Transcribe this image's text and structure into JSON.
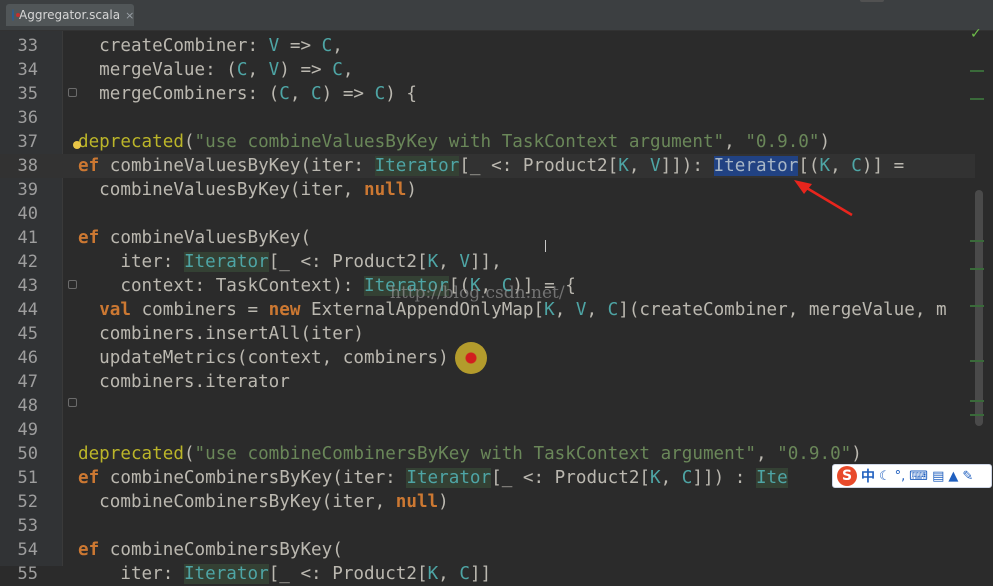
{
  "tab": {
    "title": "Aggregator.scala",
    "close": "×"
  },
  "watermark": "http://blog.csdn.net/",
  "ime": {
    "logo": "S",
    "mode": "中",
    "icons": [
      "moon-icon",
      "punctuation-icon",
      "keyboard-icon",
      "clipboard-icon",
      "shirt-icon",
      "wrench-icon"
    ]
  },
  "colors": {
    "keyword": "#cc7832",
    "string": "#6a8759",
    "type": "#4ea5a5",
    "annotation": "#bbb529",
    "selection": "#214283"
  },
  "lines": [
    {
      "n": "33",
      "t": [
        [
          "  createCombiner: ",
          ""
        ],
        [
          "V",
          "tp"
        ],
        [
          " => ",
          ""
        ],
        [
          "C",
          "tp"
        ],
        [
          ",",
          ""
        ]
      ]
    },
    {
      "n": "34",
      "t": [
        [
          "  mergeValue: (",
          ""
        ],
        [
          "C",
          "tp"
        ],
        [
          ", ",
          ""
        ],
        [
          "V",
          "tp"
        ],
        [
          ") => ",
          ""
        ],
        [
          "C",
          "tp"
        ],
        [
          ",",
          ""
        ]
      ]
    },
    {
      "n": "35",
      "t": [
        [
          "  mergeCombiners: (",
          ""
        ],
        [
          "C",
          "tp"
        ],
        [
          ", ",
          ""
        ],
        [
          "C",
          "tp"
        ],
        [
          ") => ",
          ""
        ],
        [
          "C",
          "tp"
        ],
        [
          ") {",
          ""
        ]
      ]
    },
    {
      "n": "36",
      "t": []
    },
    {
      "n": "37",
      "t": [
        [
          "deprecated",
          "ann"
        ],
        [
          "(",
          ""
        ],
        [
          "\"use combineValuesByKey with TaskContext argument\"",
          "str"
        ],
        [
          ", ",
          ""
        ],
        [
          "\"0.9.0\"",
          "str"
        ],
        [
          ")",
          ""
        ]
      ]
    },
    {
      "n": "38",
      "t": [
        [
          "ef ",
          "kw"
        ],
        [
          "combineValuesByKey(iter: ",
          ""
        ],
        [
          "Iterator",
          "tp-hl"
        ],
        [
          "[_ <: Product2[",
          ""
        ],
        [
          "K",
          "tp"
        ],
        [
          ", ",
          ""
        ],
        [
          "V",
          "tp"
        ],
        [
          "]]): ",
          ""
        ],
        [
          "Iterator",
          "sel"
        ],
        [
          "[(",
          ""
        ],
        [
          "K",
          "tp"
        ],
        [
          ", ",
          ""
        ],
        [
          "C",
          "tp"
        ],
        [
          ")] =",
          ""
        ]
      ]
    },
    {
      "n": "39",
      "t": [
        [
          "  combineValuesByKey(iter, ",
          ""
        ],
        [
          "null",
          "kw"
        ],
        [
          ")",
          ""
        ]
      ]
    },
    {
      "n": "40",
      "t": []
    },
    {
      "n": "41",
      "t": [
        [
          "ef ",
          "kw"
        ],
        [
          "combineValuesByKey(",
          ""
        ]
      ]
    },
    {
      "n": "42",
      "t": [
        [
          "    iter: ",
          ""
        ],
        [
          "Iterator",
          "tp-hl"
        ],
        [
          "[_ <: Product2[",
          ""
        ],
        [
          "K",
          "tp"
        ],
        [
          ", ",
          ""
        ],
        [
          "V",
          "tp"
        ],
        [
          "]],",
          ""
        ]
      ]
    },
    {
      "n": "43",
      "t": [
        [
          "    context: TaskContext): ",
          ""
        ],
        [
          "Iterator",
          "tp-hl"
        ],
        [
          "[(",
          ""
        ],
        [
          "K",
          "tp"
        ],
        [
          ", ",
          ""
        ],
        [
          "C",
          "tp"
        ],
        [
          ")] = {",
          ""
        ]
      ]
    },
    {
      "n": "44",
      "t": [
        [
          "  ",
          ""
        ],
        [
          "val ",
          "kw"
        ],
        [
          "combiners = ",
          ""
        ],
        [
          "new ",
          "kw"
        ],
        [
          "ExternalAppendOnlyMap[",
          ""
        ],
        [
          "K",
          "tp"
        ],
        [
          ", ",
          ""
        ],
        [
          "V",
          "tp"
        ],
        [
          ", ",
          ""
        ],
        [
          "C",
          "tp"
        ],
        [
          "](createCombiner, mergeValue, m",
          ""
        ]
      ]
    },
    {
      "n": "45",
      "t": [
        [
          "  combiners.insertAll(iter)",
          ""
        ]
      ]
    },
    {
      "n": "46",
      "t": [
        [
          "  updateMetrics(context, combiners)",
          ""
        ]
      ]
    },
    {
      "n": "47",
      "t": [
        [
          "  combiners.iterator",
          ""
        ]
      ]
    },
    {
      "n": "48",
      "t": []
    },
    {
      "n": "49",
      "t": []
    },
    {
      "n": "50",
      "t": [
        [
          "deprecated",
          "ann"
        ],
        [
          "(",
          ""
        ],
        [
          "\"use combineCombinersByKey with TaskContext argument\"",
          "str"
        ],
        [
          ", ",
          ""
        ],
        [
          "\"0.9.0\"",
          "str"
        ],
        [
          ")",
          ""
        ]
      ]
    },
    {
      "n": "51",
      "t": [
        [
          "ef ",
          "kw"
        ],
        [
          "combineCombinersByKey(iter: ",
          ""
        ],
        [
          "Iterator",
          "tp-hl"
        ],
        [
          "[_ <: Product2[",
          ""
        ],
        [
          "K",
          "tp"
        ],
        [
          ", ",
          ""
        ],
        [
          "C",
          "tp"
        ],
        [
          "]]) : ",
          ""
        ],
        [
          "Ite",
          "tp-hl"
        ]
      ]
    },
    {
      "n": "52",
      "t": [
        [
          "  combineCombinersByKey(iter, ",
          ""
        ],
        [
          "null",
          "kw"
        ],
        [
          ")",
          ""
        ]
      ]
    },
    {
      "n": "53",
      "t": []
    },
    {
      "n": "54",
      "t": [
        [
          "ef ",
          "kw"
        ],
        [
          "combineCombinersByKey(",
          ""
        ]
      ]
    },
    {
      "n": "55",
      "t": [
        [
          "    iter: ",
          ""
        ],
        [
          "Iterator",
          "tp-hl"
        ],
        [
          "[_ <: Product2[",
          ""
        ],
        [
          "K",
          "tp"
        ],
        [
          ", ",
          ""
        ],
        [
          "C",
          "tp"
        ],
        [
          "]]",
          ""
        ]
      ]
    }
  ]
}
